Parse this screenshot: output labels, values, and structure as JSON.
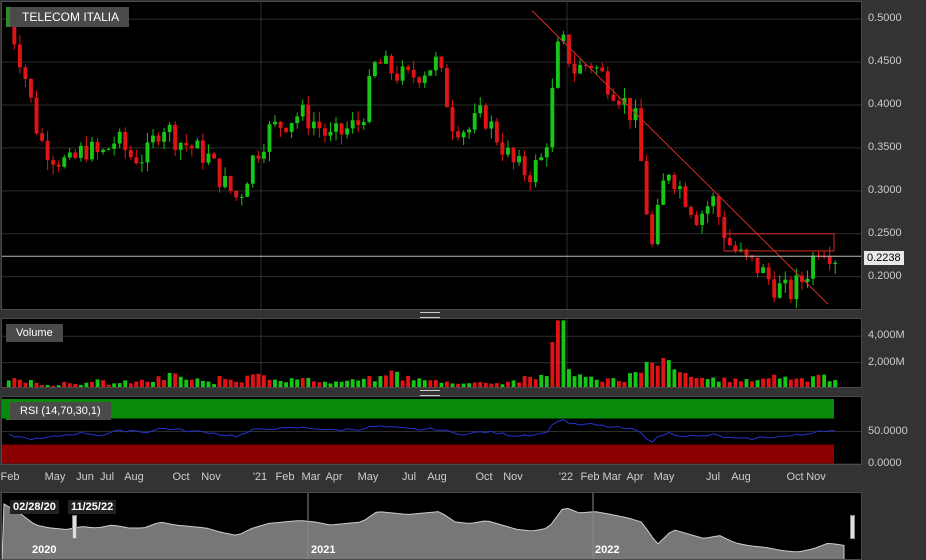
{
  "title": "TELECOM ITALIA",
  "last_price": "0.2238",
  "volume_label": "Volume",
  "rsi_label": "RSI (14,70,30,1)",
  "nav": {
    "start_date": "02/28/20",
    "end_date": "11/25/22",
    "years": [
      "2020",
      "2021",
      "2022"
    ]
  },
  "colors": {
    "up": "#16c516",
    "down": "#e01414",
    "trendline": "#d42a2a",
    "rsi_line": "#2233cc",
    "overbought_band": "#0a8a0a",
    "oversold_band": "#8a0000"
  },
  "chart_data": [
    {
      "type": "candlestick",
      "title": "TELECOM ITALIA",
      "x_labels": [
        "Feb",
        "May",
        "Jun",
        "Jul",
        "Aug",
        "Oct",
        "Nov",
        "'21",
        "Feb",
        "Mar",
        "Apr",
        "May",
        "Jul",
        "Aug",
        "Oct",
        "Nov",
        "'22",
        "Feb",
        "Mar",
        "Apr",
        "May",
        "Jul",
        "Aug",
        "Oct",
        "Nov"
      ],
      "ylim": [
        0.16,
        0.52
      ],
      "yticks": [
        "0.5000",
        "0.4500",
        "0.4000",
        "0.3500",
        "0.3000",
        "0.2500",
        "0.2000"
      ],
      "close_series": [
        0.5,
        0.44,
        0.36,
        0.34,
        0.33,
        0.35,
        0.34,
        0.36,
        0.34,
        0.34,
        0.38,
        0.36,
        0.35,
        0.34,
        0.31,
        0.29,
        0.34,
        0.37,
        0.38,
        0.39,
        0.38,
        0.36,
        0.37,
        0.38,
        0.45,
        0.44,
        0.43,
        0.44,
        0.45,
        0.38,
        0.37,
        0.39,
        0.36,
        0.33,
        0.32,
        0.34,
        0.48,
        0.44,
        0.45,
        0.43,
        0.41,
        0.38,
        0.23,
        0.33,
        0.3,
        0.27,
        0.29,
        0.24,
        0.22,
        0.21,
        0.19,
        0.18,
        0.2,
        0.24,
        0.2238
      ],
      "last_price": 0.2238,
      "annotations": [
        "descending trendline",
        "resistance box 0.23-0.25"
      ]
    },
    {
      "type": "bar",
      "title": "Volume",
      "ylim": [
        0,
        5000
      ],
      "yticks": [
        "4,000M",
        "2,000M"
      ],
      "values_M": [
        900,
        700,
        500,
        400,
        600,
        500,
        700,
        500,
        600,
        700,
        900,
        1200,
        800,
        600,
        900,
        700,
        1500,
        1100,
        800,
        900,
        800,
        600,
        700,
        800,
        900,
        1400,
        1000,
        800,
        700,
        600,
        500,
        700,
        500,
        700,
        900,
        1200,
        5200,
        1500,
        1000,
        900,
        800,
        1300,
        2000,
        2300,
        1200,
        1000,
        900,
        800,
        700,
        900,
        1100,
        1000,
        900,
        1300,
        800
      ],
      "highlight": "spike near Nov '21 ≈ 5,200M"
    },
    {
      "type": "line",
      "title": "RSI (14,70,30,1)",
      "ylim": [
        0,
        100
      ],
      "yticks": [
        "50.0000",
        "0.0000"
      ],
      "bands": {
        "overbought": [
          70,
          100
        ],
        "oversold": [
          0,
          30
        ]
      },
      "values": [
        45,
        40,
        38,
        42,
        46,
        48,
        44,
        50,
        52,
        49,
        55,
        53,
        50,
        49,
        45,
        43,
        52,
        55,
        54,
        56,
        55,
        52,
        53,
        54,
        58,
        56,
        54,
        53,
        54,
        48,
        46,
        50,
        47,
        44,
        45,
        47,
        70,
        60,
        61,
        58,
        55,
        52,
        35,
        48,
        44,
        42,
        45,
        40,
        38,
        40,
        42,
        43,
        45,
        52,
        50
      ]
    }
  ]
}
